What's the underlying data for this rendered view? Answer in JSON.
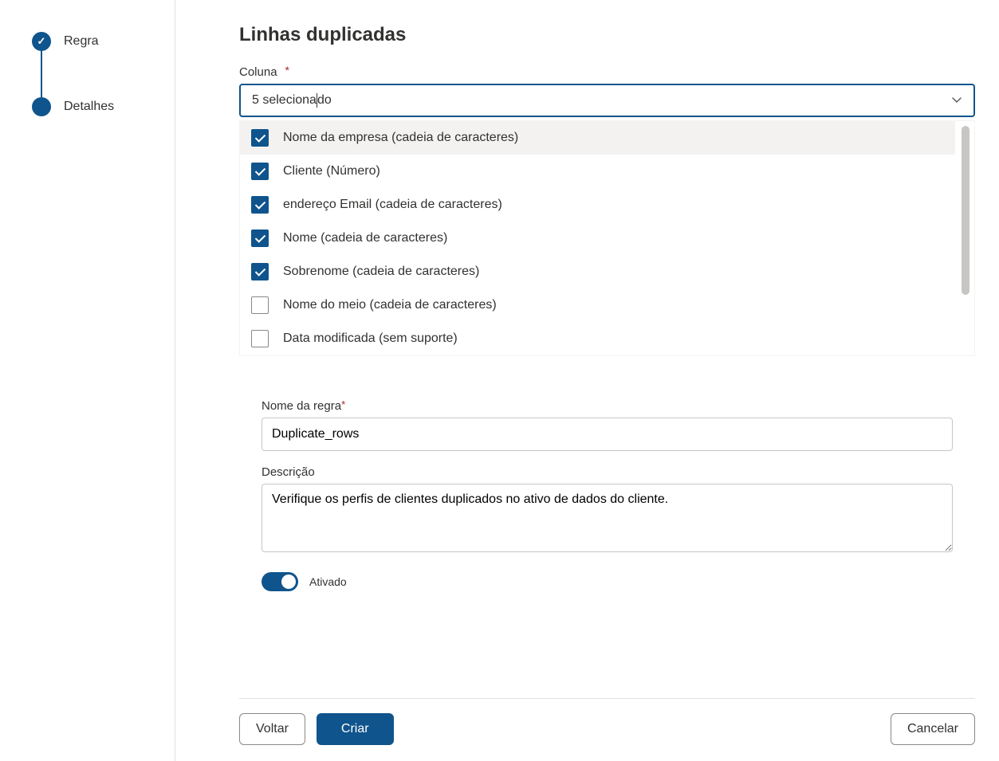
{
  "sidebar": {
    "steps": [
      {
        "label": "Regra",
        "completed": true
      },
      {
        "label": "Detalhes",
        "completed": false
      }
    ]
  },
  "main": {
    "title": "Linhas duplicadas",
    "column_field": {
      "label": "Coluna",
      "value_prefix": "5 seleciona",
      "value_suffix": "do"
    },
    "options": [
      {
        "label": "Nome da empresa (cadeia de caracteres)",
        "checked": true,
        "highlight": true
      },
      {
        "label": "Cliente (Número)",
        "checked": true,
        "highlight": false
      },
      {
        "label": "endereço Email (cadeia de caracteres)",
        "checked": true,
        "highlight": false
      },
      {
        "label": "Nome (cadeia de caracteres)",
        "checked": true,
        "highlight": false
      },
      {
        "label": "Sobrenome (cadeia de caracteres)",
        "checked": true,
        "highlight": false
      },
      {
        "label": "Nome do meio (cadeia de caracteres)",
        "checked": false,
        "highlight": false
      },
      {
        "label": "Data modificada (sem suporte)",
        "checked": false,
        "highlight": false
      }
    ],
    "rule_name": {
      "label": "Nome da regra",
      "value": "Duplicate_rows"
    },
    "description": {
      "label": "Descrição",
      "value": "Verifique os perfis de clientes duplicados no ativo de dados do cliente."
    },
    "toggle": {
      "label": "Ativado",
      "on": true
    }
  },
  "footer": {
    "back": "Voltar",
    "create": "Criar",
    "cancel": "Cancelar"
  }
}
